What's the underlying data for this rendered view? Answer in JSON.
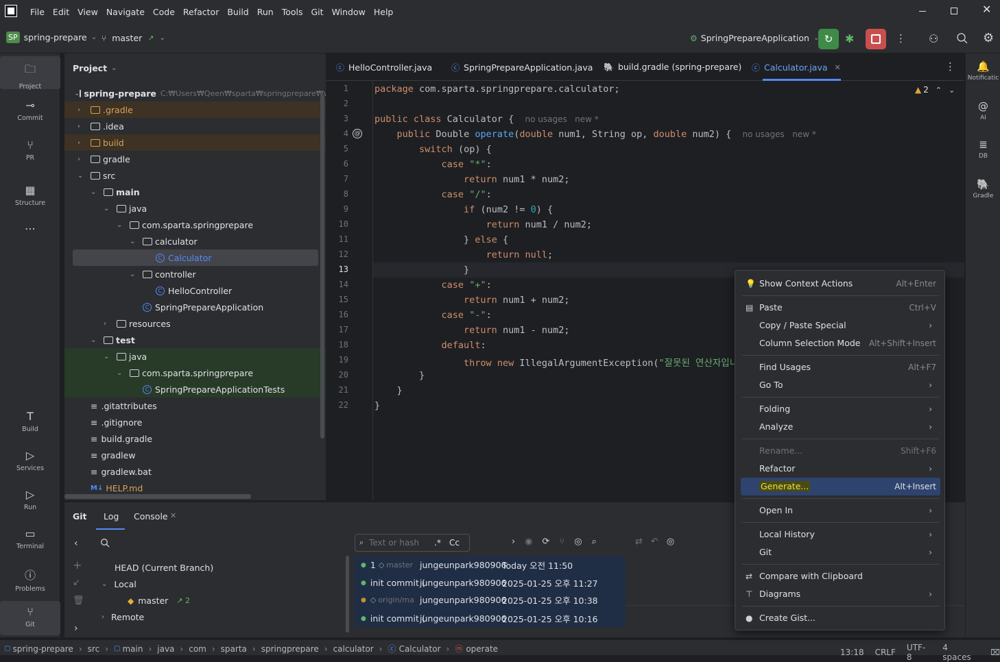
{
  "menubar": {
    "app_icon": "intellij-icon",
    "items": [
      "File",
      "Edit",
      "View",
      "Navigate",
      "Code",
      "Refactor",
      "Build",
      "Run",
      "Tools",
      "Git",
      "Window",
      "Help"
    ]
  },
  "toolbar": {
    "project_badge": "SP",
    "project_name": "spring-prepare",
    "branch": "master",
    "run_config": "SpringPrepareApplication"
  },
  "left_tools": [
    {
      "name": "folder-icon",
      "label": "Project"
    },
    {
      "name": "commit-icon",
      "label": "Commit"
    },
    {
      "name": "pull-request-icon",
      "label": "PR"
    },
    {
      "name": "structure-icon",
      "label": "Structure"
    },
    {
      "name": "more-icon",
      "label": "..."
    }
  ],
  "left_tools_bottom": [
    {
      "name": "build-icon",
      "label": "Build"
    },
    {
      "name": "services-icon",
      "label": "Services"
    },
    {
      "name": "run-icon",
      "label": "Run"
    },
    {
      "name": "terminal-icon",
      "label": "Terminal"
    },
    {
      "name": "problems-icon",
      "label": "Problems"
    },
    {
      "name": "git-icon",
      "label": "Git"
    }
  ],
  "right_tools": [
    {
      "name": "bell-icon",
      "label": "Notificatic"
    },
    {
      "name": "ai-icon",
      "label": "AI"
    },
    {
      "name": "database-icon",
      "label": "DB"
    },
    {
      "name": "gradle-icon",
      "label": "Gradle"
    }
  ],
  "project": {
    "header": "Project",
    "root_name": "spring-prepare",
    "root_path": "C:₩Users₩Qeen₩sparta₩springprepare₩we",
    "tree": [
      {
        "label": ".gradle",
        "depth": 2,
        "kind": "folder",
        "chev": ">",
        "color": "#d9a05b",
        "bg": "#3d3223"
      },
      {
        "label": ".idea",
        "depth": 2,
        "kind": "folder",
        "chev": ">"
      },
      {
        "label": "build",
        "depth": 2,
        "kind": "folder",
        "chev": ">",
        "color": "#d9a05b",
        "bg": "#3d3223"
      },
      {
        "label": "gradle",
        "depth": 2,
        "kind": "folder",
        "chev": ">"
      },
      {
        "label": "src",
        "depth": 2,
        "kind": "folder",
        "chev": "v"
      },
      {
        "label": "main",
        "depth": 3,
        "kind": "folder",
        "chev": "v",
        "bold": true
      },
      {
        "label": "java",
        "depth": 4,
        "kind": "folder",
        "chev": "v"
      },
      {
        "label": "com.sparta.springprepare",
        "depth": 5,
        "kind": "folder",
        "chev": "v"
      },
      {
        "label": "calculator",
        "depth": 6,
        "kind": "folder",
        "chev": "v"
      },
      {
        "label": "Calculator",
        "depth": 7,
        "kind": "class",
        "color": "#548af7",
        "selected": true
      },
      {
        "label": "controller",
        "depth": 6,
        "kind": "folder",
        "chev": "v"
      },
      {
        "label": "HelloController",
        "depth": 7,
        "kind": "class"
      },
      {
        "label": "SpringPrepareApplication",
        "depth": 6,
        "kind": "class"
      },
      {
        "label": "resources",
        "depth": 4,
        "kind": "folder",
        "chev": ">"
      },
      {
        "label": "test",
        "depth": 3,
        "kind": "folder",
        "chev": "v",
        "bold": true
      },
      {
        "label": "java",
        "depth": 4,
        "kind": "folder",
        "chev": "v",
        "bg": "#283a28"
      },
      {
        "label": "com.sparta.springprepare",
        "depth": 5,
        "kind": "folder",
        "chev": "v",
        "bg": "#283a28"
      },
      {
        "label": "SpringPrepareApplicationTests",
        "depth": 6,
        "kind": "class",
        "bg": "#283a28"
      },
      {
        "label": ".gitattributes",
        "depth": 2,
        "kind": "text"
      },
      {
        "label": ".gitignore",
        "depth": 2,
        "kind": "text"
      },
      {
        "label": "build.gradle",
        "depth": 2,
        "kind": "text"
      },
      {
        "label": "gradlew",
        "depth": 2,
        "kind": "text"
      },
      {
        "label": "gradlew.bat",
        "depth": 2,
        "kind": "text"
      },
      {
        "label": "HELP.md",
        "depth": 2,
        "kind": "md",
        "color": "#d9a05b"
      }
    ]
  },
  "editor": {
    "tabs": [
      "HelloController.java",
      "SpringPrepareApplication.java",
      "build.gradle (spring-prepare)",
      "Calculator.java"
    ],
    "active_tab": "Calculator.java",
    "warnings": "2",
    "line_numbers": [
      "1",
      "2",
      "3",
      "4",
      "5",
      "6",
      "7",
      "8",
      "9",
      "10",
      "11",
      "12",
      "13",
      "14",
      "15",
      "16",
      "17",
      "18",
      "19",
      "20",
      "21",
      "22"
    ],
    "current_line": "13"
  },
  "context_menu": {
    "items": [
      {
        "label": "Show Context Actions",
        "shortcut": "Alt+Enter",
        "icon": "bulb-icon"
      },
      {
        "sep": true
      },
      {
        "label": "Paste",
        "shortcut": "Ctrl+V",
        "icon": "clipboard-icon"
      },
      {
        "label": "Copy / Paste Special",
        "arrow": true
      },
      {
        "label": "Column Selection Mode",
        "shortcut": "Alt+Shift+Insert"
      },
      {
        "sep": true
      },
      {
        "label": "Find Usages",
        "shortcut": "Alt+F7"
      },
      {
        "label": "Go To",
        "arrow": true
      },
      {
        "sep": true
      },
      {
        "label": "Folding",
        "arrow": true
      },
      {
        "label": "Analyze",
        "arrow": true
      },
      {
        "sep": true
      },
      {
        "label": "Rename...",
        "shortcut": "Shift+F6",
        "disabled": true
      },
      {
        "label": "Refactor",
        "arrow": true
      },
      {
        "label": "Generate...",
        "shortcut": "Alt+Insert",
        "selected": true
      },
      {
        "sep": true
      },
      {
        "label": "Open In",
        "arrow": true
      },
      {
        "sep": true
      },
      {
        "label": "Local History",
        "arrow": true
      },
      {
        "label": "Git",
        "arrow": true
      },
      {
        "sep": true
      },
      {
        "label": "Compare with Clipboard",
        "icon": "compare-icon"
      },
      {
        "label": "Diagrams",
        "arrow": true,
        "icon": "diagram-icon"
      },
      {
        "sep": true
      },
      {
        "label": "Create Gist...",
        "icon": "github-icon"
      }
    ]
  },
  "bottom": {
    "tabs": [
      "Git",
      "Log",
      "Console"
    ],
    "active_tab": "Log",
    "branches": {
      "head": "HEAD (Current Branch)",
      "local": "Local",
      "master": "master",
      "master_ahead": "↗ 2",
      "remote": "Remote"
    },
    "search_placeholder": "Text or hash",
    "regex": ".*",
    "case": "Cc",
    "commits": [
      {
        "msg": "1",
        "tag": "master",
        "author": "jungeunpark980906",
        "date": "Today 오전 11:50"
      },
      {
        "msg": "init commit (",
        "tag": "",
        "author": "jungeunpark980906",
        "date": "2025-01-25 오후 11:27"
      },
      {
        "msg": "",
        "tag": "origin/ma",
        "author": "jungeunpark980906",
        "date": "2025-01-25 오후 10:38"
      },
      {
        "msg": "init commit (",
        "tag": "",
        "author": "jungeunpark980906",
        "date": "2025-01-25 오후 10:16"
      }
    ]
  },
  "statusbar": {
    "breadcrumbs": [
      "spring-prepare",
      "src",
      "main",
      "java",
      "com",
      "sparta",
      "springprepare",
      "calculator",
      "Calculator",
      "operate"
    ],
    "position": "13:18",
    "line_sep": "CRLF",
    "encoding": "UTF-8",
    "indent": "4 spaces"
  }
}
